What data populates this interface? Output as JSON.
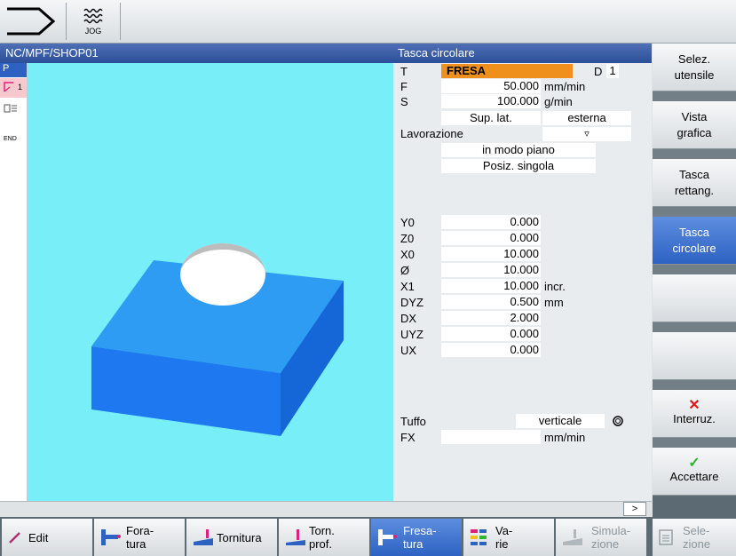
{
  "top": {
    "mode_label": "JOG"
  },
  "header": {
    "program_path": "NC/MPF/SHOP01",
    "cycle_title": "Tasca circolare"
  },
  "leftbar": {
    "items": [
      "P",
      "1",
      "END"
    ]
  },
  "form": {
    "T": {
      "label": "T",
      "value": "FRESA",
      "d_label": "D",
      "d_value": "1"
    },
    "F": {
      "label": "F",
      "value": "50.000",
      "unit": "mm/min"
    },
    "S": {
      "label": "S",
      "value": "100.000",
      "unit": "g/min"
    },
    "sup": {
      "value": "Sup. lat.",
      "mode": "esterna"
    },
    "lavorazione": {
      "label": "Lavorazione",
      "dropdown": "▿",
      "opt1": "in modo piano",
      "opt2": "Posiz. singola"
    },
    "Y0": {
      "label": "Y0",
      "value": "0.000"
    },
    "Z0": {
      "label": "Z0",
      "value": "0.000"
    },
    "X0": {
      "label": "X0",
      "value": "10.000"
    },
    "D": {
      "label": "Ø",
      "value": "10.000"
    },
    "X1": {
      "label": "X1",
      "value": "10.000",
      "unit": "incr."
    },
    "DYZ": {
      "label": "DYZ",
      "value": "0.500",
      "unit": "mm"
    },
    "DX": {
      "label": "DX",
      "value": "2.000"
    },
    "UYZ": {
      "label": "UYZ",
      "value": "0.000"
    },
    "UX": {
      "label": "UX",
      "value": "0.000"
    },
    "tuffo": {
      "label": "Tuffo",
      "value": "verticale"
    },
    "FX": {
      "label": "FX",
      "value": "",
      "unit": "mm/min"
    }
  },
  "softkeys": {
    "sel_utensile": [
      "Selez.",
      "utensile"
    ],
    "vista_grafica": [
      "Vista",
      "grafica"
    ],
    "tasca_rett": [
      "Tasca",
      "rettang."
    ],
    "tasca_circ": [
      "Tasca",
      "circolare"
    ],
    "interruz": "Interruz.",
    "accettare": "Accettare"
  },
  "statusbar": {
    "next": ">"
  },
  "hsoft": {
    "edit": "Edit",
    "foratura": [
      "Fora-",
      "tura"
    ],
    "tornitura": "Tornitura",
    "torn_prof": [
      "Torn.",
      "prof."
    ],
    "fresatura": [
      "Fresa-",
      "tura"
    ],
    "varie": [
      "Va-",
      "rie"
    ],
    "simulazione": [
      "Simula-",
      "zione"
    ],
    "selezione": [
      "Sele-",
      "zione"
    ]
  },
  "colors": {
    "header": "#2b4f98",
    "graphic_bg": "#78eef8",
    "active_key": "#2e62c2",
    "tool_field": "#f0901c",
    "part_top": "#2d9cf2",
    "part_front": "#1e78f0"
  }
}
